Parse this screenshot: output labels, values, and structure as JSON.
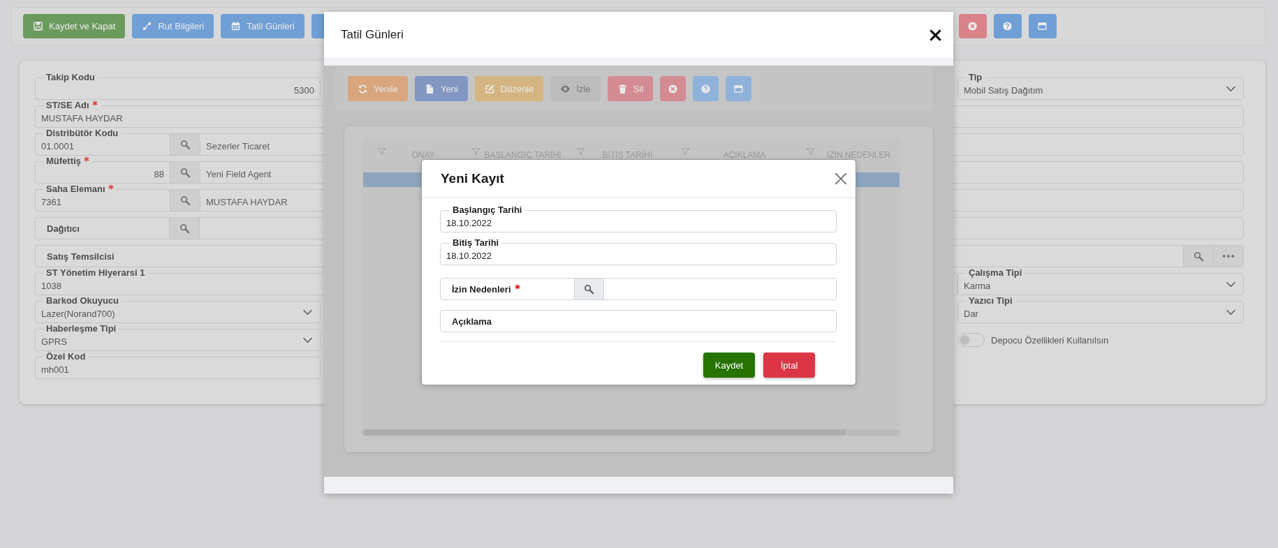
{
  "toolbar": [
    {
      "label": "Kaydet ve Kapat",
      "kind": "save",
      "color": "#6b9a5d"
    },
    {
      "label": "Rut Bilgileri",
      "kind": "route",
      "color": "#6f9fd5"
    },
    {
      "label": "Tatil Günleri",
      "kind": "calendar",
      "color": "#6f9fd5"
    },
    {
      "kind": "blank",
      "color": "#6f9fd5"
    },
    {
      "kind": "close",
      "color": "#d9828a"
    },
    {
      "kind": "help",
      "color": "#6f9fd5"
    },
    {
      "kind": "panel",
      "color": "#6f9fd5"
    }
  ],
  "form": {
    "rows": [
      {
        "left": {
          "kind": "text",
          "label": "Takip Kodu",
          "value": "5300",
          "numeric": true,
          "required": false
        },
        "right": {
          "kind": "select",
          "label": "Tip",
          "value": "Mobil Satış Dağıtım",
          "required": false
        }
      },
      {
        "full": {
          "kind": "text",
          "label": "ST/SE Adı",
          "value": "MUSTAFA HAYDAR",
          "numeric": false,
          "required": true
        }
      },
      {
        "full": {
          "kind": "lookup",
          "label": "Distribütör Kodu",
          "value": "01.0001",
          "description": "Sezerler Ticaret",
          "numeric": false,
          "required": false
        }
      },
      {
        "full": {
          "kind": "lookup",
          "label": "Müfettiş",
          "value": "88",
          "description": "Yeni Field Agent",
          "numeric": true,
          "required": true
        }
      },
      {
        "full": {
          "kind": "lookup",
          "label": "Saha Elemanı",
          "value": "7361",
          "description": "MUSTAFA HAYDAR",
          "numeric": false,
          "required": true
        }
      },
      {
        "full": {
          "kind": "inline-lookup",
          "label": "Dağıtıcı",
          "required": false
        }
      },
      {
        "full": {
          "kind": "inline-picker",
          "label": "Satış Temsilcisi",
          "required": false
        }
      },
      {
        "wide": {
          "kind": "text",
          "label": "ST Yönetim Hiyerarsi 1",
          "value": "1038",
          "numeric": false,
          "required": false
        },
        "right": {
          "kind": "select",
          "label": "Çalışma Tipi",
          "value": "Karma",
          "required": false
        }
      },
      {
        "left": {
          "kind": "select",
          "label": "Barkod Okuyucu",
          "value": "Lazer(Norand700)",
          "required": false
        },
        "right": {
          "kind": "select",
          "label": "Yazıcı Tipi",
          "value": "Dar",
          "required": false
        }
      },
      {
        "left": {
          "kind": "select",
          "label": "Haberleşme Tipi",
          "value": "GPRS",
          "required": false
        },
        "right": {
          "kind": "toggle",
          "label": "Depocu Özellikleri Kullanılsın",
          "checked": false
        }
      },
      {
        "left": {
          "kind": "text",
          "label": "Özel Kod",
          "value": "mh001",
          "numeric": false,
          "required": false
        }
      }
    ]
  },
  "modal": {
    "title": "Tatil Günleri",
    "toolbar": [
      {
        "label": "Yenile",
        "kind": "refresh",
        "color": "#d8a57c",
        "disabled": false
      },
      {
        "label": "Yeni",
        "kind": "file",
        "color": "#8196c1",
        "disabled": false
      },
      {
        "label": "Düzenle",
        "kind": "edit",
        "color": "#d4b582",
        "disabled": false
      },
      {
        "label": "İzle",
        "kind": "eye",
        "color": "#bcbcbc",
        "disabled": true
      },
      {
        "label": "Sil",
        "kind": "trash",
        "color": "#d58b92",
        "disabled": false
      },
      {
        "kind": "close",
        "color": "#d58b92",
        "disabled": false
      },
      {
        "kind": "help",
        "color": "#8eb2d9",
        "disabled": false
      },
      {
        "kind": "panel",
        "color": "#8eb2d9",
        "disabled": false
      }
    ],
    "grid": {
      "columns": [
        "ONAY",
        "BAŞLANGIÇ TARİHİ",
        "BİTİŞ TARİHİ",
        "AÇIKLAMA",
        "İZİN NEDENLER"
      ],
      "rows": [
        {
          "selected": true
        }
      ]
    },
    "dialog": {
      "title": "Yeni Kayıt",
      "fields": [
        {
          "kind": "text",
          "label": "Başlangıç Tarihi",
          "value": "18.10.2022",
          "numeric": false,
          "required": false
        },
        {
          "kind": "text",
          "label": "Bitiş Tarihi",
          "value": "18.10.2022",
          "numeric": false,
          "required": false
        },
        {
          "kind": "inline-lookup",
          "label": "İzin Nedenleri",
          "required": true
        },
        {
          "kind": "inline-text",
          "label": "Açıklama",
          "required": false
        }
      ],
      "buttons": [
        {
          "label": "Kaydet",
          "color": "#267300"
        },
        {
          "label": "İptal",
          "color": "#dc3545"
        }
      ]
    }
  }
}
